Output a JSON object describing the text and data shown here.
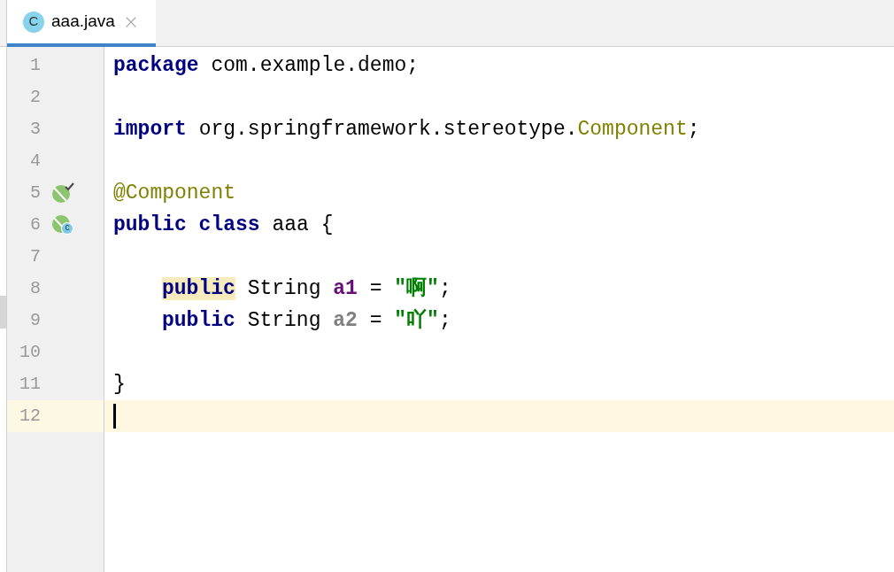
{
  "tabs": [
    {
      "label": "aaa.java",
      "icon_letter": "C",
      "selected": true
    }
  ],
  "lines": [
    {
      "number": "1",
      "current": false,
      "indented": false,
      "tokens": [
        {
          "text": "package",
          "kind": "keyword"
        },
        {
          "text": " com.example.demo;",
          "kind": "plain"
        }
      ]
    },
    {
      "number": "2",
      "current": false
    },
    {
      "number": "3",
      "current": false,
      "indented": false,
      "tokens": [
        {
          "text": "import",
          "kind": "keyword"
        },
        {
          "text": " org.springframework.stereotype.",
          "kind": "plain"
        },
        {
          "text": "Component",
          "kind": "type"
        },
        {
          "text": ";",
          "kind": "plain"
        }
      ]
    },
    {
      "number": "4",
      "current": false
    },
    {
      "number": "5",
      "current": false,
      "indented": false,
      "gutter_icon": {
        "kind": "bean-check"
      },
      "tokens": [
        {
          "text": "@Component",
          "kind": "annotation"
        }
      ]
    },
    {
      "number": "6",
      "current": false,
      "indented": false,
      "gutter_icon": {
        "kind": "bean-class",
        "letter": "c"
      },
      "tokens": [
        {
          "text": "public class",
          "kind": "keyword"
        },
        {
          "text": " aaa {",
          "kind": "plain"
        }
      ]
    },
    {
      "number": "7",
      "current": false
    },
    {
      "number": "8",
      "current": false,
      "indented": true,
      "tokens": [
        {
          "text": "public",
          "kind": "keyword",
          "highlighted": true
        },
        {
          "text": " String ",
          "kind": "plain"
        },
        {
          "text": "a1",
          "kind": "field"
        },
        {
          "text": " = ",
          "kind": "plain"
        },
        {
          "text": "\"啊\"",
          "kind": "string"
        },
        {
          "text": ";",
          "kind": "plain"
        }
      ]
    },
    {
      "number": "9",
      "current": false,
      "indented": true,
      "tokens": [
        {
          "text": "public",
          "kind": "keyword"
        },
        {
          "text": " String ",
          "kind": "plain"
        },
        {
          "text": "a2",
          "kind": "unused-field"
        },
        {
          "text": " = ",
          "kind": "plain"
        },
        {
          "text": "\"吖\"",
          "kind": "string"
        },
        {
          "text": ";",
          "kind": "plain"
        }
      ]
    },
    {
      "number": "10",
      "current": false
    },
    {
      "number": "11",
      "current": false,
      "indented": false,
      "tokens": [
        {
          "text": "}",
          "kind": "plain"
        }
      ]
    },
    {
      "number": "12",
      "current": true
    }
  ]
}
